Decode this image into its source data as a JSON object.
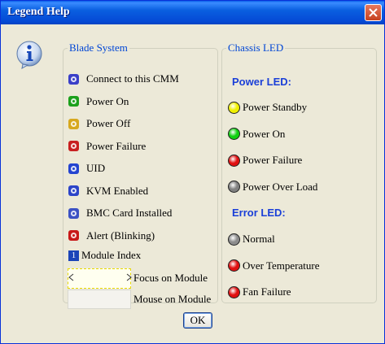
{
  "dialog": {
    "title": "Legend Help",
    "ok_label": "OK"
  },
  "blade": {
    "legend": "Blade System",
    "items": [
      {
        "label": "Connect to this CMM",
        "icon": "connect-cmm-icon",
        "color": "#3a3fc8"
      },
      {
        "label": "Power On",
        "icon": "power-on-icon",
        "color": "#1ca01c"
      },
      {
        "label": "Power Off",
        "icon": "power-off-icon",
        "color": "#d7a81f"
      },
      {
        "label": "Power Failure",
        "icon": "power-failure-icon",
        "color": "#c82020"
      },
      {
        "label": "UID",
        "icon": "uid-icon",
        "color": "#2444d0"
      },
      {
        "label": "KVM Enabled",
        "icon": "kvm-icon",
        "color": "#2c44c8"
      },
      {
        "label": "BMC Card Installed",
        "icon": "bmc-icon",
        "color": "#3c52c4"
      },
      {
        "label": "Alert (Blinking)",
        "icon": "alert-icon",
        "color": "#c81818"
      }
    ],
    "index_glyph": "1",
    "index_label": "Module Index",
    "focus_label": "Focus on Module",
    "mouse_label": "Mouse on Module"
  },
  "chassis": {
    "legend": "Chassis LED",
    "power_header": "Power LED:",
    "power_items": [
      {
        "label": "Power Standby",
        "color": "#f0f000"
      },
      {
        "label": "Power On",
        "color": "#10d010"
      },
      {
        "label": "Power Failure",
        "color": "#e01010"
      },
      {
        "label": "Power Over Load",
        "color": "#808080"
      }
    ],
    "error_header": "Error LED:",
    "error_items": [
      {
        "label": "Normal",
        "color": "#8c8c8c"
      },
      {
        "label": "Over Temperature",
        "color": "#e01010"
      },
      {
        "label": "Fan Failure",
        "color": "#e01010"
      }
    ]
  }
}
